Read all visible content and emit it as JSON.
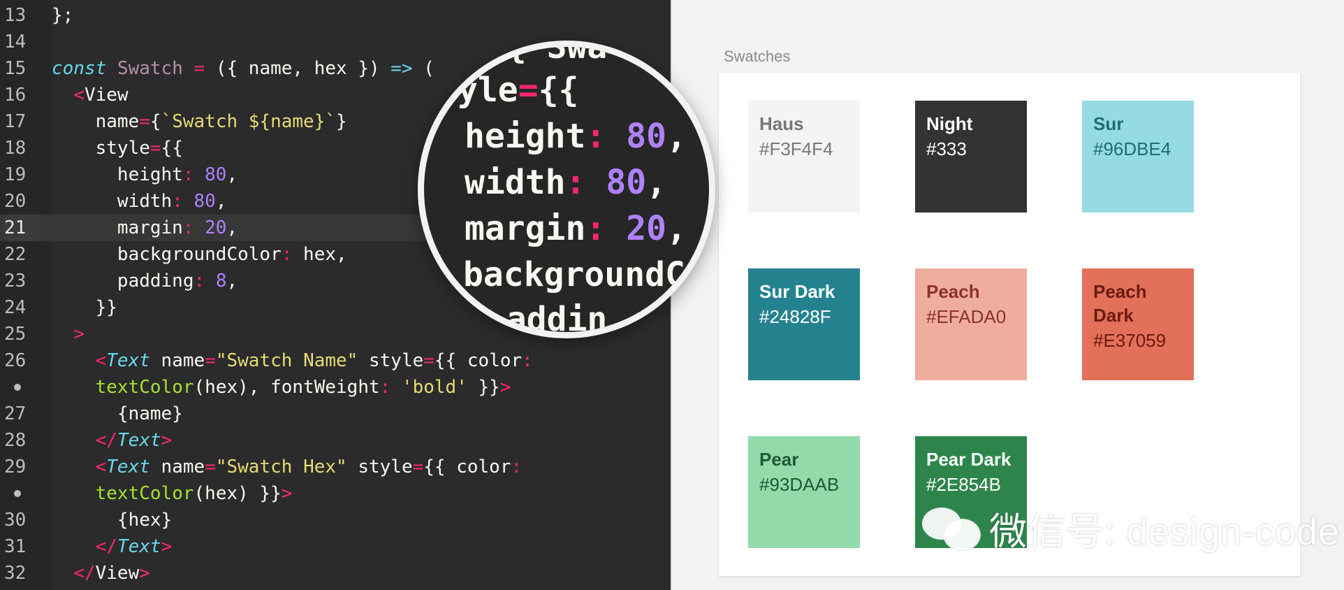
{
  "editor": {
    "lines": [
      {
        "num": "13",
        "html": "};"
      },
      {
        "num": "14",
        "html": ""
      },
      {
        "num": "15",
        "html": "<span class='kw'>const</span> <span class='cls'>Swatch</span> <span class='op'>=</span> ({ name, hex }) <span class='kw'>=></span> ("
      },
      {
        "num": "16",
        "html": "  <span class='tagb'>&lt;</span>View"
      },
      {
        "num": "17",
        "html": "    name<span class='op'>=</span>{<span class='str'>`Swatch ${name}`</span>}"
      },
      {
        "num": "18",
        "html": "    style<span class='op'>=</span>{{"
      },
      {
        "num": "19",
        "html": "      height<span class='op'>:</span> <span class='val'>80</span>,"
      },
      {
        "num": "20",
        "html": "      width<span class='op'>:</span> <span class='val'>80</span>,"
      },
      {
        "num": "21",
        "html": "      margin<span class='op'>:</span> <span class='val'>20</span>,",
        "active": true
      },
      {
        "num": "22",
        "html": "      backgroundColor<span class='op'>:</span> hex,"
      },
      {
        "num": "23",
        "html": "      padding<span class='op'>:</span> <span class='val'>8</span>,"
      },
      {
        "num": "24",
        "html": "    }}"
      },
      {
        "num": "25",
        "html": "  <span class='tagb'>&gt;</span>"
      },
      {
        "num": "26",
        "html": "    <span class='tagb'>&lt;</span><span class='tagi'>Text</span> name<span class='op'>=</span><span class='str'>\"Swatch Name\"</span> style<span class='op'>=</span>{{ color<span class='op'>:</span>"
      },
      {
        "num": "",
        "bullet": true,
        "html": "    <span class='fn'>textColor</span>(hex), fontWeight<span class='op'>:</span> <span class='str'>'bold'</span> }}<span class='tagb'>&gt;</span>"
      },
      {
        "num": "27",
        "html": "      {name}"
      },
      {
        "num": "28",
        "html": "    <span class='tagb'>&lt;/</span><span class='tagi'>Text</span><span class='tagb'>&gt;</span>"
      },
      {
        "num": "29",
        "html": "    <span class='tagb'>&lt;</span><span class='tagi'>Text</span> name<span class='op'>=</span><span class='str'>\"Swatch Hex\"</span> style<span class='op'>=</span>{{ color<span class='op'>:</span>"
      },
      {
        "num": "",
        "bullet": true,
        "html": "    <span class='fn'>textColor</span>(hex) }}<span class='tagb'>&gt;</span>"
      },
      {
        "num": "30",
        "html": "      {hex}"
      },
      {
        "num": "31",
        "html": "    <span class='tagb'>&lt;/</span><span class='tagi'>Text</span><span class='tagb'>&gt;</span>"
      },
      {
        "num": "32",
        "html": "  <span class='tagb'>&lt;/</span>View<span class='tagb'>&gt;</span>"
      }
    ]
  },
  "magnifier": {
    "lines": [
      "  { Swa",
      "yle={{",
      "height: 80,",
      "width: 80,",
      "margin: 20,",
      "backgroundC",
      "  addin"
    ]
  },
  "artboard": {
    "label": "Swatches",
    "swatches": [
      {
        "name": "Haus",
        "hex": "#F3F4F4",
        "bg": "#F3F4F4",
        "text": "#777777"
      },
      {
        "name": "Night",
        "hex": "#333",
        "bg": "#333333",
        "text": "#ffffff"
      },
      {
        "name": "Sur",
        "hex": "#96DBE4",
        "bg": "#96DBE4",
        "text": "#1e6d78"
      },
      {
        "name": "Sur Dark",
        "hex": "#24828F",
        "bg": "#24828F",
        "text": "#ffffff"
      },
      {
        "name": "Peach",
        "hex": "#EFADA0",
        "bg": "#EFADA0",
        "text": "#8a3326"
      },
      {
        "name": "Peach Dark",
        "hex": "#E37059",
        "bg": "#E37059",
        "text": "#6a1b10"
      },
      {
        "name": "Pear",
        "hex": "#93DAAB",
        "bg": "#93DAAB",
        "text": "#1f5a33"
      },
      {
        "name": "Pear Dark",
        "hex": "#2E854B",
        "bg": "#2E854B",
        "text": "#ffffff"
      }
    ]
  },
  "watermark": {
    "text": "微信号: design-code",
    "icon": "wechat-icon"
  }
}
